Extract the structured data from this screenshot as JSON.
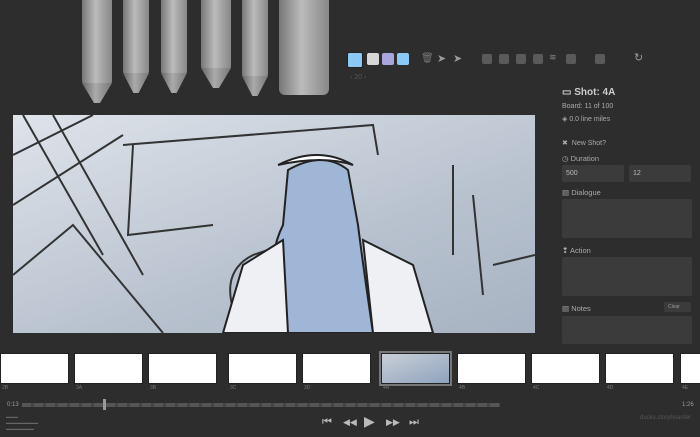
{
  "toolbar": {
    "tools": [
      "light-pencil",
      "brush",
      "pen",
      "marker",
      "soft-pencil",
      "eraser"
    ],
    "colors": [
      "#8cc8f5",
      "#d7d7d7",
      "#a9a6dd",
      "#8cc8f5"
    ],
    "brush_size": "20"
  },
  "inspector": {
    "shot_title": "Shot: 4A",
    "board_info": "Board: 11 of 100",
    "line_miles": "0.0 line miles",
    "new_shot_label": "New Shot?",
    "duration_label": "Duration",
    "duration_ms": "500",
    "duration_frames": "12",
    "dialogue_label": "Dialogue",
    "action_label": "Action",
    "notes_label": "Notes",
    "clear_label": "Clear"
  },
  "timeline": {
    "thumbs": [
      {
        "label": "2B",
        "active": false
      },
      {
        "label": "3A",
        "active": false
      },
      {
        "label": "3B",
        "active": false
      },
      {
        "label": "3C",
        "active": false
      },
      {
        "label": "3D",
        "active": false
      },
      {
        "label": "4A",
        "active": true
      },
      {
        "label": "4B",
        "active": false
      },
      {
        "label": "4C",
        "active": false
      },
      {
        "label": "4D",
        "active": false
      },
      {
        "label": "4E",
        "active": false
      }
    ],
    "start_time": "0:13",
    "end_time": "1:26",
    "progress": 0.17,
    "file_name": "ducks.storyboarder"
  }
}
